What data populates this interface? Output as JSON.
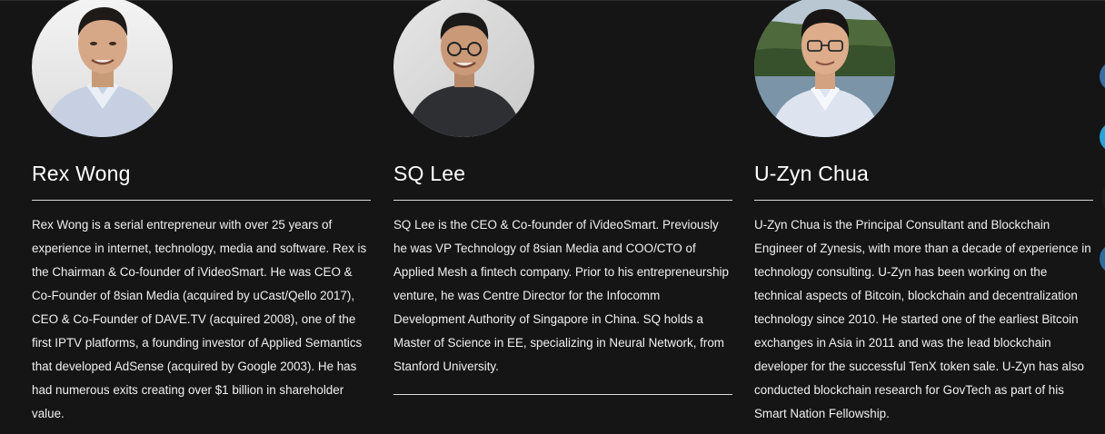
{
  "team": [
    {
      "name": "Rex Wong",
      "avatar_icon": "portrait-photo",
      "bio": "Rex Wong is a serial entrepreneur with over 25 years of experience in internet, technology, media and software. Rex is the Chairman & Co-founder of iVideoSmart. He was CEO & Co-Founder of 8sian Media (acquired by uCast/Qello 2017), CEO & Co-Founder of DAVE.TV (acquired 2008), one of the first IPTV platforms, a founding investor of Applied Semantics that developed AdSense (acquired by Google 2003). He has had numerous exits creating over $1 billion in shareholder value."
    },
    {
      "name": "SQ Lee",
      "avatar_icon": "portrait-photo",
      "bio": "SQ Lee is the CEO & Co-founder of iVideoSmart. Previously he was VP Technology of 8sian Media and COO/CTO of Applied Mesh a fintech company. Prior to his entrepreneurship venture, he was Centre Director for the Infocomm Development Authority of Singapore in China. SQ holds a Master of Science in EE, specializing in Neural Network, from Stanford University."
    },
    {
      "name": "U-Zyn Chua",
      "avatar_icon": "portrait-photo",
      "bio": "U-Zyn Chua is the Principal Consultant and Blockchain Engineer of Zynesis, with more than a decade of experience in technology consulting. U-Zyn has been working on the technical aspects of Bitcoin, blockchain and decentralization technology since 2010. He started one of the earliest Bitcoin exchanges in Asia in 2011 and was the lead blockchain developer for the successful TenX token sale. U-Zyn has also conducted blockchain research for GovTech as part of his Smart Nation Fellowship."
    }
  ],
  "colors": {
    "background": "#151516",
    "text": "#ffffff",
    "divider": "#d9d9d9",
    "side_buttons": [
      "#3b6ea5",
      "#2aa3d9",
      "#2e6c9c"
    ]
  }
}
